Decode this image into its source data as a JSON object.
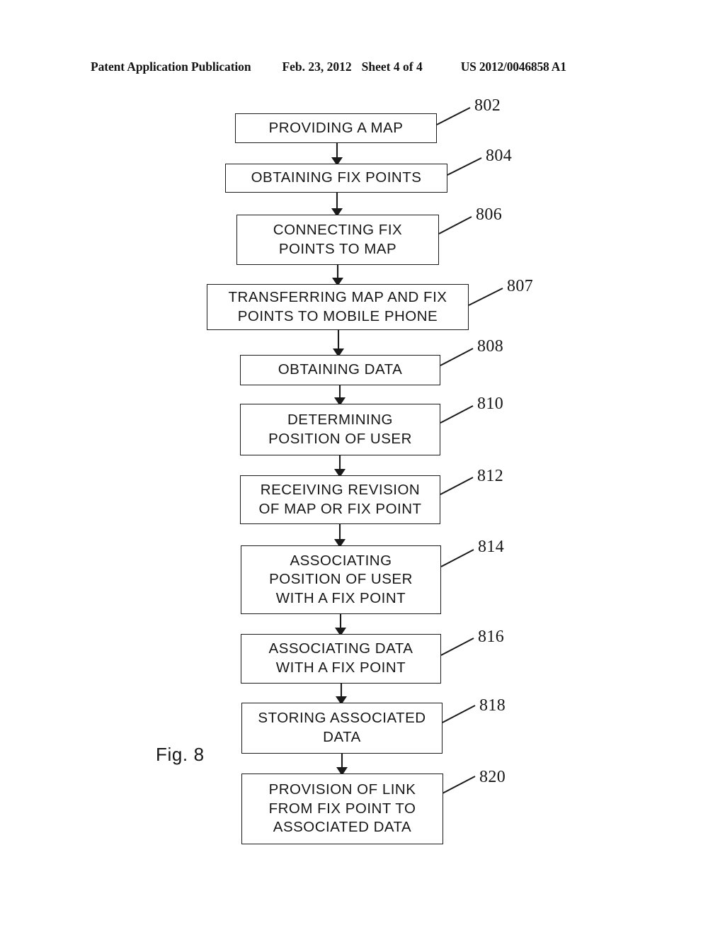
{
  "header": {
    "publication": "Patent Application Publication",
    "date": "Feb. 23, 2012",
    "sheet": "Sheet 4 of 4",
    "publication_number": "US 2012/0046858 A1"
  },
  "figure": {
    "caption": "Fig. 8",
    "type": "flowchart",
    "steps": [
      {
        "ref": "802",
        "text": "PROVIDING A MAP",
        "lines": [
          "PROVIDING A MAP"
        ]
      },
      {
        "ref": "804",
        "text": "OBTAINING FIX POINTS",
        "lines": [
          "OBTAINING FIX POINTS"
        ]
      },
      {
        "ref": "806",
        "text": "CONNECTING FIX POINTS TO MAP",
        "lines": [
          "CONNECTING FIX",
          "POINTS TO MAP"
        ]
      },
      {
        "ref": "807",
        "text": "TRANSFERRING MAP AND FIX POINTS TO MOBILE PHONE",
        "lines": [
          "TRANSFERRING MAP AND FIX",
          "POINTS TO MOBILE PHONE"
        ]
      },
      {
        "ref": "808",
        "text": "OBTAINING DATA",
        "lines": [
          "OBTAINING DATA"
        ]
      },
      {
        "ref": "810",
        "text": "DETERMINING POSITION OF USER",
        "lines": [
          "DETERMINING",
          "POSITION OF USER"
        ]
      },
      {
        "ref": "812",
        "text": "RECEIVING REVISION OF MAP OR FIX POINT",
        "lines": [
          "RECEIVING REVISION",
          "OF MAP OR FIX POINT"
        ]
      },
      {
        "ref": "814",
        "text": "ASSOCIATING POSITION OF USER WITH A FIX POINT",
        "lines": [
          "ASSOCIATING",
          "POSITION OF USER",
          "WITH A FIX POINT"
        ]
      },
      {
        "ref": "816",
        "text": "ASSOCIATING DATA WITH A FIX POINT",
        "lines": [
          "ASSOCIATING DATA",
          "WITH A FIX POINT"
        ]
      },
      {
        "ref": "818",
        "text": "STORING ASSOCIATED DATA",
        "lines": [
          "STORING ASSOCIATED",
          "DATA"
        ]
      },
      {
        "ref": "820",
        "text": "PROVISION OF LINK FROM FIX POINT TO ASSOCIATED DATA",
        "lines": [
          "PROVISION OF LINK",
          "FROM FIX POINT TO",
          "ASSOCIATED DATA"
        ]
      }
    ]
  },
  "colors": {
    "ink": "#171717",
    "page": "#ffffff"
  }
}
